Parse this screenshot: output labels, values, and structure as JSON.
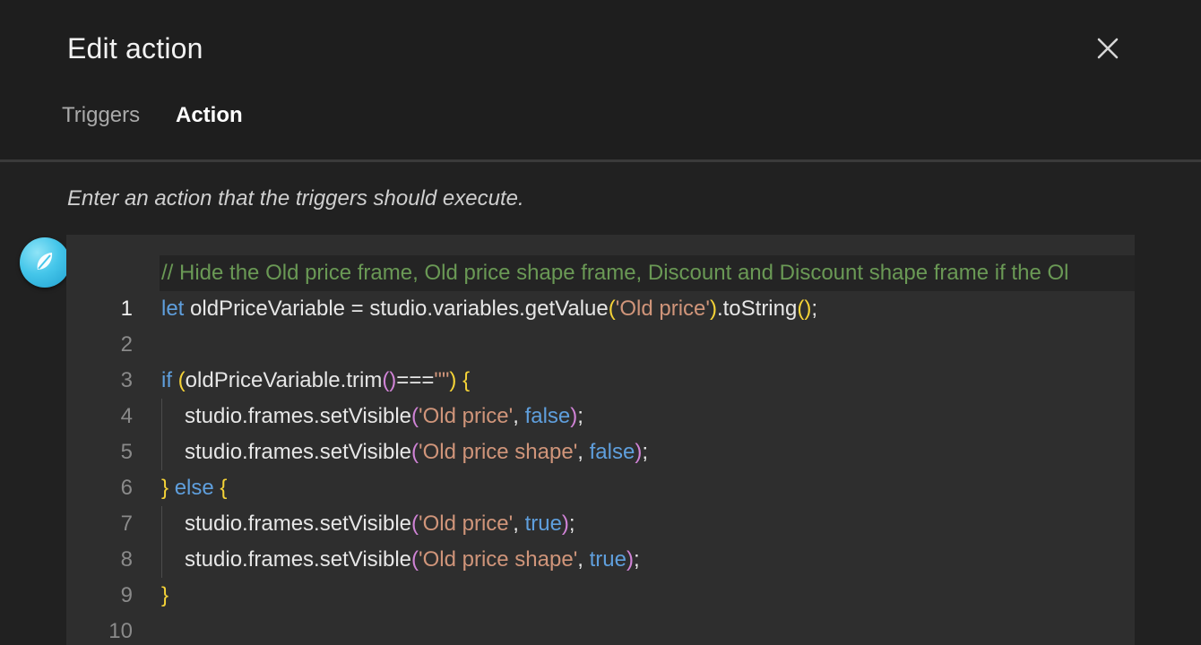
{
  "dialog": {
    "title": "Edit action",
    "close_icon": "close-icon"
  },
  "tabs": [
    {
      "label": "Triggers",
      "active": false
    },
    {
      "label": "Action",
      "active": true
    }
  ],
  "hint": "Enter an action that the triggers should execute.",
  "avatar": {
    "icon": "assistant-logo-icon",
    "color": "#45c6ea"
  },
  "colors": {
    "background": "#212121",
    "editor_background": "#2e2e2e",
    "comment": "#6a9955",
    "keyword": "#5f9fdd",
    "string": "#d0957a",
    "paren_level1": "#f5d337",
    "paren_level2": "#d083d6"
  },
  "editor": {
    "current_line": 1,
    "lines": [
      {
        "number": "1",
        "text": "// Hide the Old price frame, Old price shape frame, Discount and Discount shape frame if the Ol"
      },
      {
        "number": "2",
        "text": "let oldPriceVariable = studio.variables.getValue('Old price').toString();"
      },
      {
        "number": "3",
        "text": ""
      },
      {
        "number": "4",
        "text": "if (oldPriceVariable.trim()===\"\") {"
      },
      {
        "number": "5",
        "text": "studio.frames.setVisible('Old price', false);"
      },
      {
        "number": "6",
        "text": "studio.frames.setVisible('Old price shape', false);"
      },
      {
        "number": "7",
        "text": "} else {"
      },
      {
        "number": "8",
        "text": "studio.frames.setVisible('Old price', true);"
      },
      {
        "number": "9",
        "text": "studio.frames.setVisible('Old price shape', true);"
      },
      {
        "number": "10",
        "text": "}"
      }
    ]
  }
}
